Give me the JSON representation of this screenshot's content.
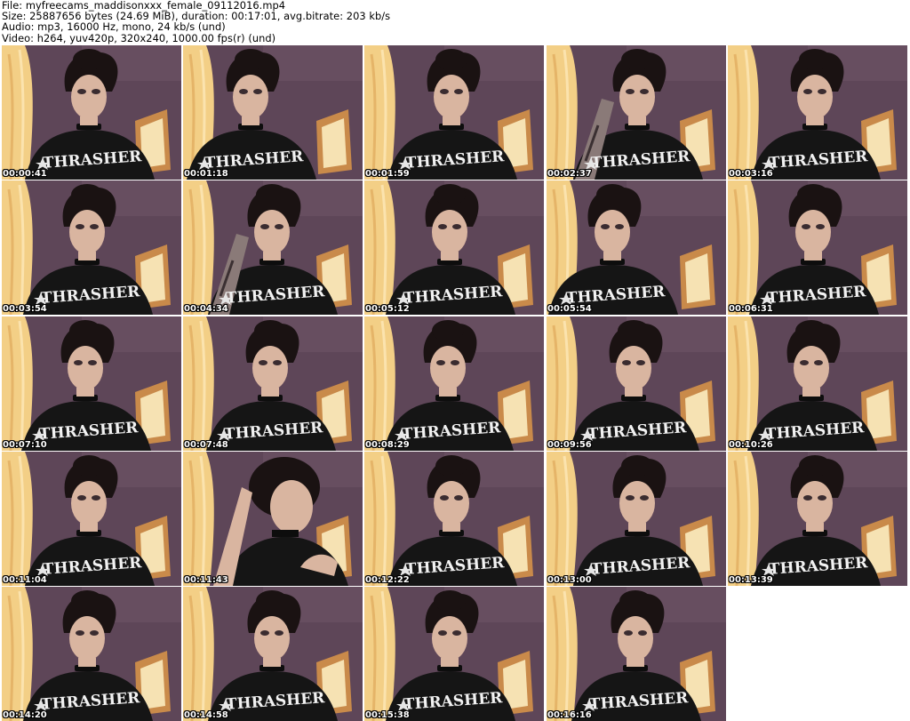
{
  "header": {
    "file_line": "File: myfreecams_maddisonxxx_female_09112016.mp4",
    "size_line": "Size: 25887656 bytes (24.69 MiB), duration: 00:17:01, avg.bitrate: 203 kb/s",
    "audio_line": "Audio: mp3, 16000 Hz, mono, 24 kb/s (und)",
    "video_line": "Video: h264, yuv420p, 320x240, 1000.00 fps(r) (und)"
  },
  "thumbnails": [
    {
      "timestamp": "00:00:41",
      "variant": "front"
    },
    {
      "timestamp": "00:01:18",
      "variant": "turned"
    },
    {
      "timestamp": "00:01:59",
      "variant": "front"
    },
    {
      "timestamp": "00:02:37",
      "variant": "arm"
    },
    {
      "timestamp": "00:03:16",
      "variant": "front"
    },
    {
      "timestamp": "00:03:54",
      "variant": "front"
    },
    {
      "timestamp": "00:04:34",
      "variant": "arm"
    },
    {
      "timestamp": "00:05:12",
      "variant": "front"
    },
    {
      "timestamp": "00:05:54",
      "variant": "turned"
    },
    {
      "timestamp": "00:06:31",
      "variant": "front"
    },
    {
      "timestamp": "00:07:10",
      "variant": "front"
    },
    {
      "timestamp": "00:07:48",
      "variant": "front"
    },
    {
      "timestamp": "00:08:29",
      "variant": "front"
    },
    {
      "timestamp": "00:09:56",
      "variant": "front"
    },
    {
      "timestamp": "00:10:26",
      "variant": "front"
    },
    {
      "timestamp": "00:11:04",
      "variant": "front"
    },
    {
      "timestamp": "00:11:43",
      "variant": "close"
    },
    {
      "timestamp": "00:12:22",
      "variant": "front"
    },
    {
      "timestamp": "00:13:00",
      "variant": "front"
    },
    {
      "timestamp": "00:13:39",
      "variant": "front"
    },
    {
      "timestamp": "00:14:20",
      "variant": "front"
    },
    {
      "timestamp": "00:14:58",
      "variant": "front"
    },
    {
      "timestamp": "00:15:38",
      "variant": "front"
    },
    {
      "timestamp": "00:16:16",
      "variant": "front"
    }
  ],
  "shirt_text": "THRASHER",
  "colors": {
    "background": "#ffffff",
    "wall": "#5e4658",
    "curtain": "#f3cf86",
    "shirt": "#151515",
    "skin": "#d9b5a0",
    "hair": "#1a1212",
    "frame": "#c98a4a"
  }
}
